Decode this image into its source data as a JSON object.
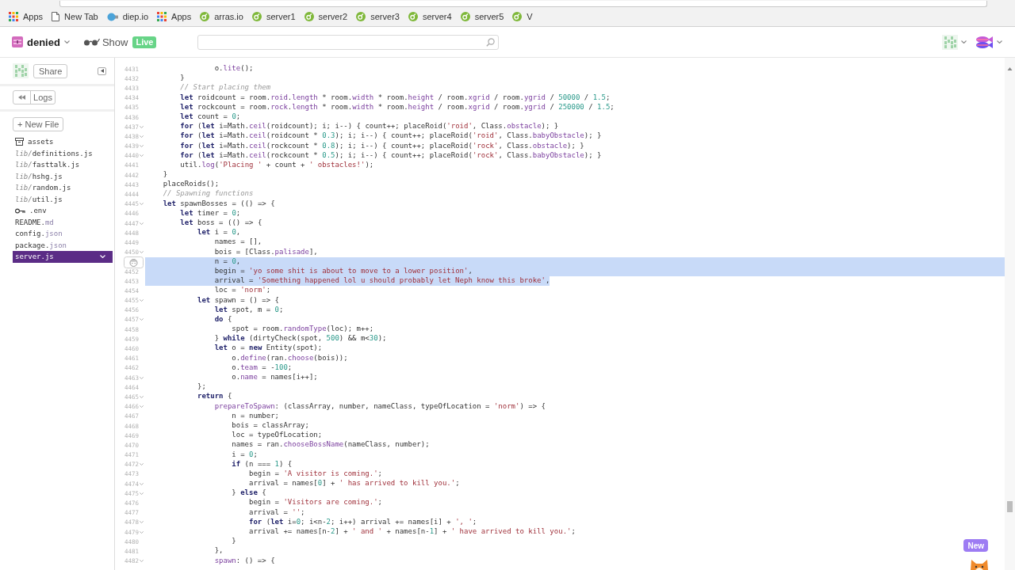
{
  "browser": {
    "bookmarks": [
      {
        "label": "Apps",
        "kind": "apps"
      },
      {
        "label": "New Tab",
        "kind": "page"
      },
      {
        "label": "diep.io",
        "kind": "site"
      },
      {
        "label": "Apps",
        "kind": "apps"
      },
      {
        "label": "arras.io",
        "kind": "glitch"
      },
      {
        "label": "server1",
        "kind": "glitch"
      },
      {
        "label": "server2",
        "kind": "glitch"
      },
      {
        "label": "server3",
        "kind": "glitch"
      },
      {
        "label": "server4",
        "kind": "glitch"
      },
      {
        "label": "server5",
        "kind": "glitch"
      },
      {
        "label": "V",
        "kind": "glitch"
      }
    ]
  },
  "header": {
    "project": "denied",
    "show_label": "Show",
    "live_badge": "Live"
  },
  "sidebar": {
    "share_button": "Share",
    "logs_button": "Logs",
    "new_file_button": "+ New File",
    "files": [
      {
        "kind": "folder",
        "name": "assets",
        "selected": false
      },
      {
        "kind": "file",
        "dir": "lib/",
        "name": "definitions.js",
        "selected": false
      },
      {
        "kind": "file",
        "dir": "lib/",
        "name": "fasttalk.js",
        "selected": false
      },
      {
        "kind": "file",
        "dir": "lib/",
        "name": "hshg.js",
        "selected": false
      },
      {
        "kind": "file",
        "dir": "lib/",
        "name": "random.js",
        "selected": false
      },
      {
        "kind": "file",
        "dir": "lib/",
        "name": "util.js",
        "selected": false
      },
      {
        "kind": "env",
        "name": ".env",
        "selected": false
      },
      {
        "kind": "file",
        "name": "README.",
        "ext": "md",
        "selected": false
      },
      {
        "kind": "file",
        "name": "config.",
        "ext": "json",
        "selected": false
      },
      {
        "kind": "file",
        "name": "package.",
        "ext": "json",
        "selected": false
      },
      {
        "kind": "file",
        "name": "server.js",
        "selected": true
      }
    ]
  },
  "editor": {
    "lines": [
      {
        "number": "4431",
        "kind": "code",
        "text": "                o.lite();",
        "foldable": false,
        "selected": false
      },
      {
        "number": "4432",
        "kind": "code",
        "text": "        }",
        "foldable": false,
        "selected": false
      },
      {
        "number": "4433",
        "kind": "comment",
        "text": "        // Start placing them",
        "foldable": false,
        "selected": false
      },
      {
        "number": "4434",
        "kind": "code",
        "text": "        **let** roidcount = room.roid.length * room.width * room.height / room.xgrid / room.ygrid / 50000 / 1.5;",
        "foldable": false,
        "selected": false
      },
      {
        "number": "4435",
        "kind": "code",
        "text": "        **let** rockcount = room.rock.length * room.width * room.height / room.xgrid / room.ygrid / 250000 / 1.5;",
        "foldable": false,
        "selected": false
      },
      {
        "number": "4436",
        "kind": "code",
        "text": "        **let** count = 0;",
        "foldable": false,
        "selected": false
      },
      {
        "number": "4437",
        "kind": "code",
        "text": "        **for** (**let** i=Math.ceil(roidcount); i; i--) { count++; placeRoid('roid', Class.obstacle); }",
        "foldable": true,
        "selected": false
      },
      {
        "number": "4438",
        "kind": "code",
        "text": "        **for** (**let** i=Math.ceil(roidcount * 0.3); i; i--) { count++; placeRoid('roid', Class.babyObstacle); }",
        "foldable": true,
        "selected": false
      },
      {
        "number": "4439",
        "kind": "code",
        "text": "        **for** (**let** i=Math.ceil(rockcount * 0.8); i; i--) { count++; placeRoid('rock', Class.obstacle); }",
        "foldable": true,
        "selected": false
      },
      {
        "number": "4440",
        "kind": "code",
        "text": "        **for** (**let** i=Math.ceil(rockcount * 0.5); i; i--) { count++; placeRoid('rock', Class.babyObstacle); }",
        "foldable": true,
        "selected": false
      },
      {
        "number": "4441",
        "kind": "code",
        "text": "        util.log('Placing ' + count + ' obstacles!');",
        "foldable": false,
        "selected": false
      },
      {
        "number": "4442",
        "kind": "code",
        "text": "    }",
        "foldable": false,
        "selected": false
      },
      {
        "number": "4443",
        "kind": "code",
        "text": "    placeRoids();",
        "foldable": false,
        "selected": false
      },
      {
        "number": "4444",
        "kind": "comment",
        "text": "    // Spawning functions",
        "foldable": false,
        "selected": false
      },
      {
        "number": "4445",
        "kind": "code",
        "text": "    **let** spawnBosses = (() => {",
        "foldable": true,
        "selected": false
      },
      {
        "number": "4446",
        "kind": "code",
        "text": "        **let** timer = 0;",
        "foldable": false,
        "selected": false
      },
      {
        "number": "4447",
        "kind": "code",
        "text": "        **let** boss = (() => {",
        "foldable": true,
        "selected": false
      },
      {
        "number": "4448",
        "kind": "code",
        "text": "            **let** i = 0,",
        "foldable": false,
        "selected": false
      },
      {
        "number": "4449",
        "kind": "code",
        "text": "                names = [],",
        "foldable": false,
        "selected": false
      },
      {
        "number": "4450",
        "kind": "code",
        "text": "                bois = [Class.palisade],",
        "foldable": true,
        "selected": false
      },
      {
        "kind": "code",
        "text": "                n = 0,",
        "foldable": false,
        "selected": true
      },
      {
        "number": "4452",
        "kind": "code",
        "text": "                begin = 'yo some shit is about to move to a lower position',",
        "foldable": false,
        "selected": true
      },
      {
        "number": "4453",
        "kind": "code",
        "text": "                arrival = 'Something happened lol u should probably let Neph know this broke',",
        "foldable": false,
        "selected": true
      },
      {
        "number": "4454",
        "kind": "code",
        "text": "                loc = 'norm';",
        "foldable": false,
        "selected": false
      },
      {
        "number": "4455",
        "kind": "code",
        "text": "            **let** spawn = () => {",
        "foldable": true,
        "selected": false
      },
      {
        "number": "4456",
        "kind": "code",
        "text": "                **let** spot, m = 0;",
        "foldable": false,
        "selected": false
      },
      {
        "number": "4457",
        "kind": "code",
        "text": "                **do** {",
        "foldable": true,
        "selected": false
      },
      {
        "number": "4458",
        "kind": "code",
        "text": "                    spot = room.randomType(loc); m++;",
        "foldable": false,
        "selected": false
      },
      {
        "number": "4459",
        "kind": "code",
        "text": "                } **while** (dirtyCheck(spot, 500) && m<30);",
        "foldable": false,
        "selected": false
      },
      {
        "number": "4460",
        "kind": "code",
        "text": "                **let** o = **new** Entity(spot);",
        "foldable": false,
        "selected": false
      },
      {
        "number": "4461",
        "kind": "code",
        "text": "                    o.define(ran.choose(bois));",
        "foldable": false,
        "selected": false
      },
      {
        "number": "4462",
        "kind": "code",
        "text": "                    o.team = -100;",
        "foldable": false,
        "selected": false
      },
      {
        "number": "4463",
        "kind": "code",
        "text": "                    o.name = names[i++];",
        "foldable": true,
        "selected": false
      },
      {
        "number": "4464",
        "kind": "code",
        "text": "            };",
        "foldable": false,
        "selected": false
      },
      {
        "number": "4465",
        "kind": "code",
        "text": "            **return** {",
        "foldable": true,
        "selected": false
      },
      {
        "number": "4466",
        "kind": "code",
        "text": "                prepareToSpawn: (classArray, number, nameClass, typeOfLocation = 'norm') => {",
        "foldable": true,
        "selected": false
      },
      {
        "number": "4467",
        "kind": "code",
        "text": "                    n = number;",
        "foldable": false,
        "selected": false
      },
      {
        "number": "4468",
        "kind": "code",
        "text": "                    bois = classArray;",
        "foldable": false,
        "selected": false
      },
      {
        "number": "4469",
        "kind": "code",
        "text": "                    loc = typeOfLocation;",
        "foldable": false,
        "selected": false
      },
      {
        "number": "4470",
        "kind": "code",
        "text": "                    names = ran.chooseBossName(nameClass, number);",
        "foldable": false,
        "selected": false
      },
      {
        "number": "4471",
        "kind": "code",
        "text": "                    i = 0;",
        "foldable": false,
        "selected": false
      },
      {
        "number": "4472",
        "kind": "code",
        "text": "                    **if** (n === 1) {",
        "foldable": true,
        "selected": false
      },
      {
        "number": "4473",
        "kind": "code",
        "text": "                        begin = 'A visitor is coming.';",
        "foldable": false,
        "selected": false
      },
      {
        "number": "4474",
        "kind": "code",
        "text": "                        arrival = names[0] + ' has arrived to kill you.';",
        "foldable": true,
        "selected": false
      },
      {
        "number": "4475",
        "kind": "code",
        "text": "                    } **else** {",
        "foldable": true,
        "selected": false
      },
      {
        "number": "4476",
        "kind": "code",
        "text": "                        begin = 'Visitors are coming.';",
        "foldable": false,
        "selected": false
      },
      {
        "number": "4477",
        "kind": "code",
        "text": "                        arrival = '';",
        "foldable": false,
        "selected": false
      },
      {
        "number": "4478",
        "kind": "code",
        "text": "                        **for** (**let** i=0; i<n-2; i++) arrival += names[i] + ', ';",
        "foldable": true,
        "selected": false
      },
      {
        "number": "4479",
        "kind": "code",
        "text": "                        arrival += names[n-2] + ' and ' + names[n-1] + ' have arrived to kill you.';",
        "foldable": true,
        "selected": false
      },
      {
        "number": "4480",
        "kind": "code",
        "text": "                    }",
        "foldable": false,
        "selected": false
      },
      {
        "number": "4481",
        "kind": "code",
        "text": "                },",
        "foldable": false,
        "selected": false
      },
      {
        "number": "4482",
        "kind": "code",
        "text": "                spawn: () => {",
        "foldable": true,
        "selected": false
      }
    ]
  },
  "new_button": "New"
}
